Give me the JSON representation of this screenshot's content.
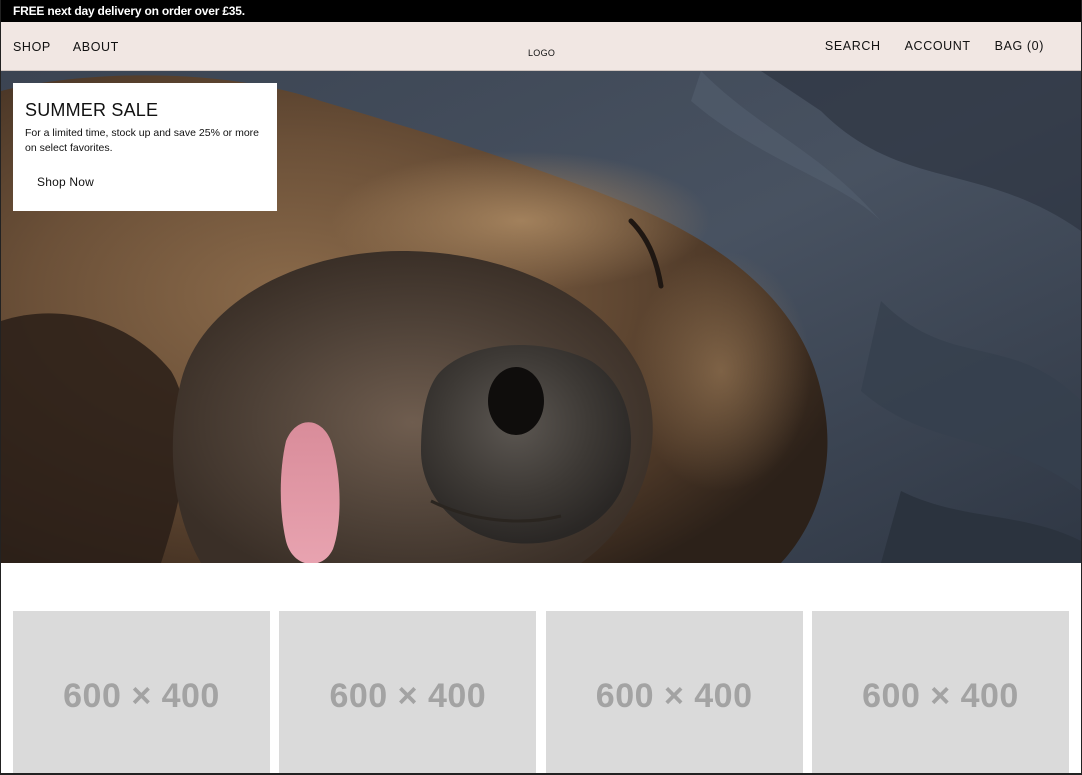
{
  "announcement": {
    "text": "FREE next day delivery on order over £35."
  },
  "header": {
    "nav_left": [
      "SHOP",
      "ABOUT"
    ],
    "logo": "LOGO",
    "nav_right": [
      "SEARCH",
      "ACCOUNT",
      "BAG (0)"
    ]
  },
  "hero": {
    "image_description_icon": "hero-photo",
    "promo": {
      "title": "SUMMER SALE",
      "text": "For a limited time, stock up and save 25% or more on select favorites.",
      "button": "Shop Now"
    }
  },
  "tiles": [
    {
      "label": "600 × 400"
    },
    {
      "label": "600 × 400"
    },
    {
      "label": "600 × 400"
    },
    {
      "label": "600 × 400"
    }
  ],
  "colors": {
    "announcement_bg": "#000000",
    "header_bg": "#f1e7e3",
    "tile_bg": "#dadada",
    "tile_text": "#a3a3a3"
  }
}
